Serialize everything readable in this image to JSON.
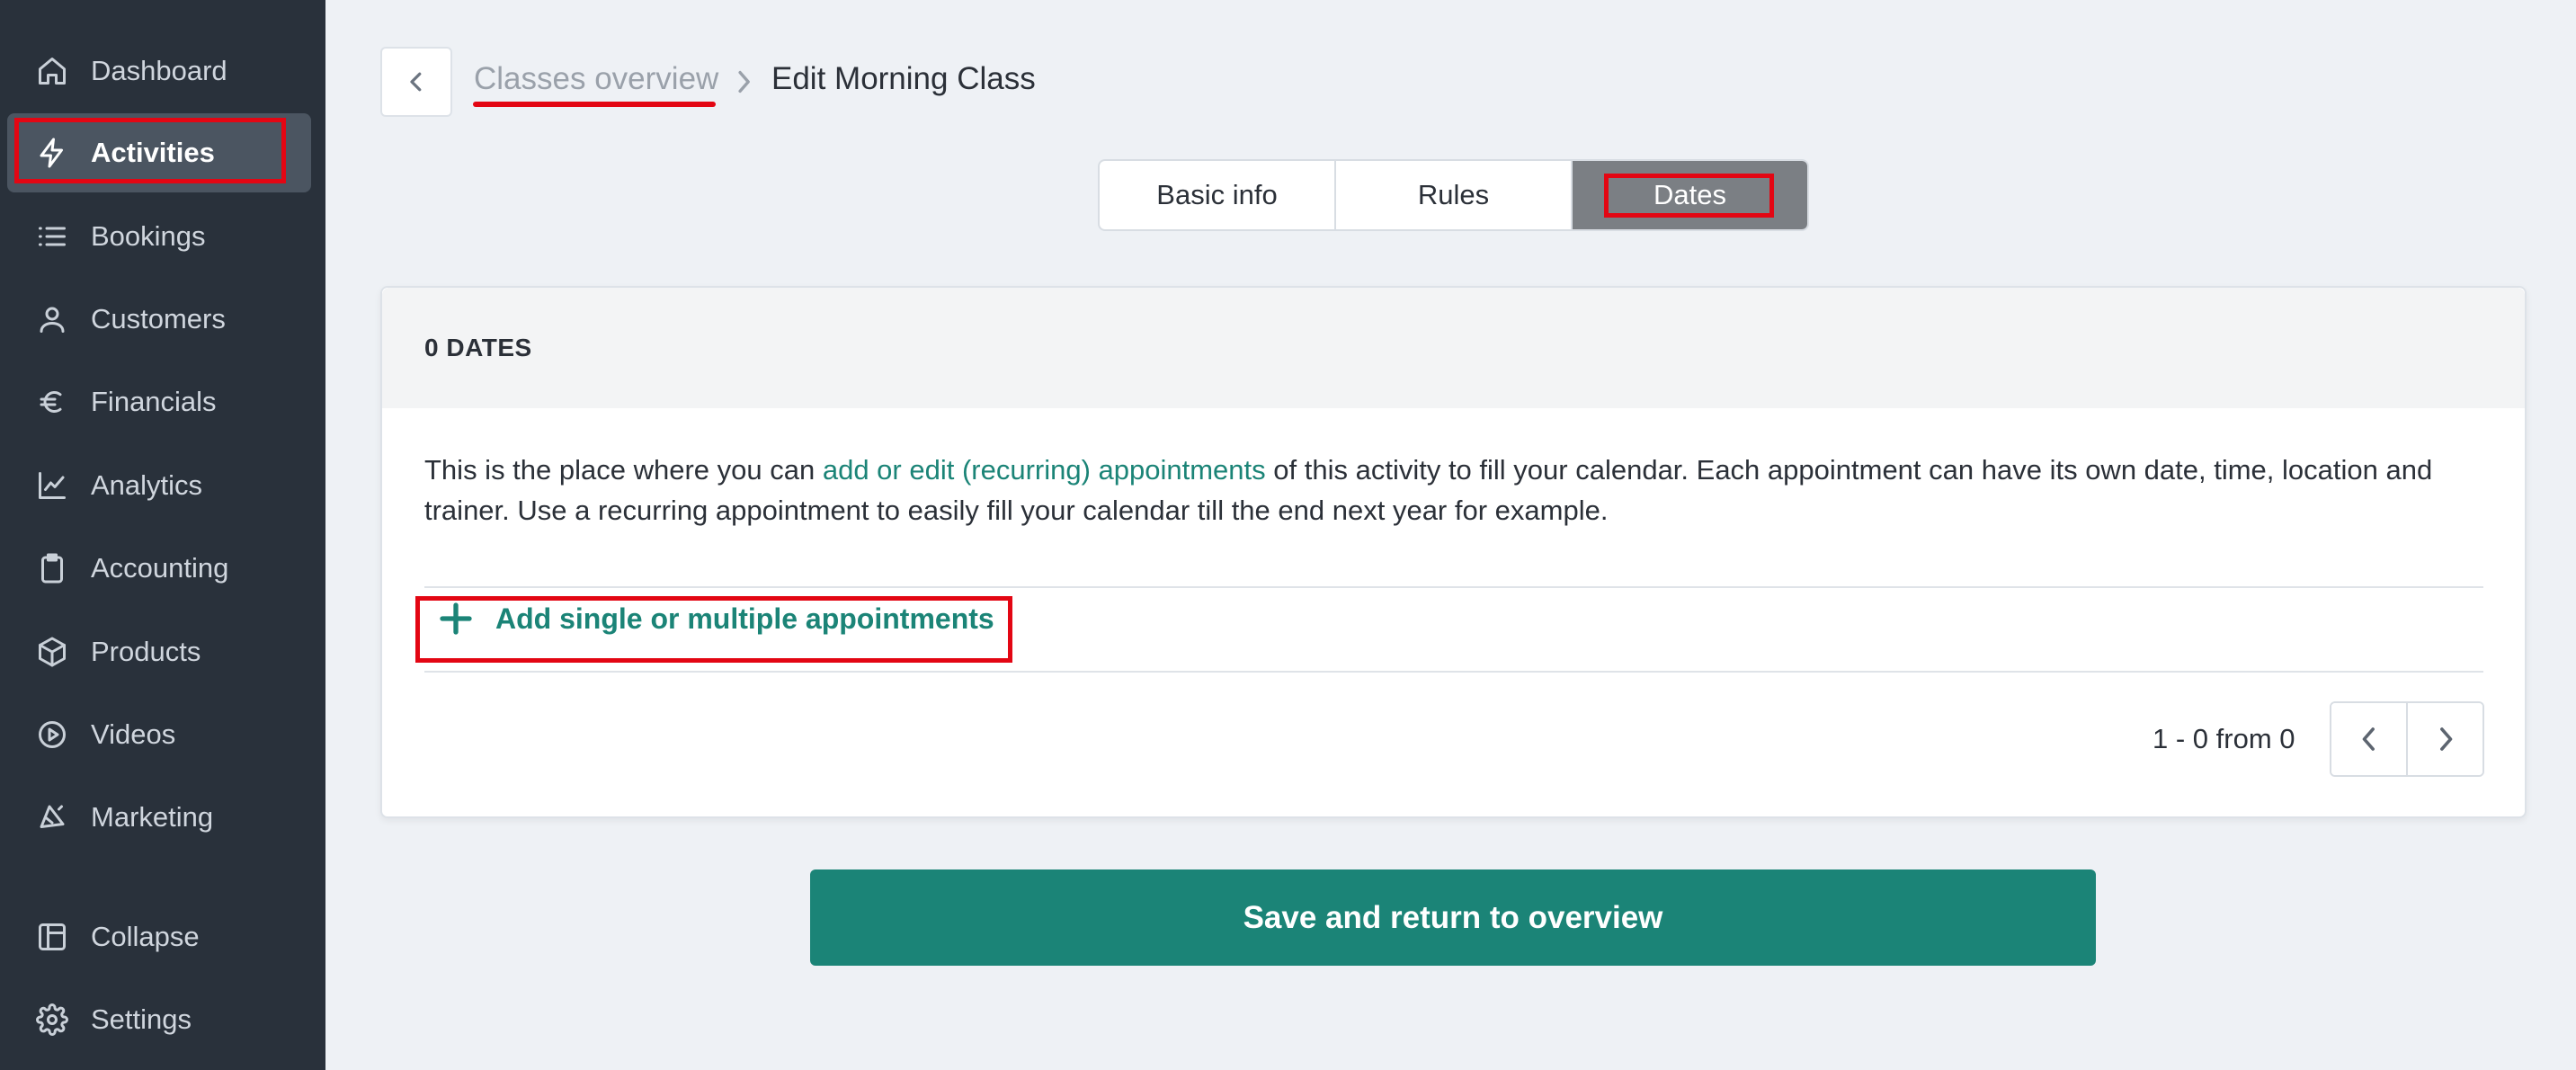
{
  "sidebar": {
    "items": [
      {
        "label": "Dashboard",
        "icon": "home-icon"
      },
      {
        "label": "Activities",
        "icon": "lightning-icon",
        "active": true
      },
      {
        "label": "Bookings",
        "icon": "list-icon"
      },
      {
        "label": "Customers",
        "icon": "user-icon"
      },
      {
        "label": "Financials",
        "icon": "euro-icon"
      },
      {
        "label": "Analytics",
        "icon": "chart-line-icon"
      },
      {
        "label": "Accounting",
        "icon": "clipboard-icon"
      },
      {
        "label": "Products",
        "icon": "box-icon"
      },
      {
        "label": "Videos",
        "icon": "play-circle-icon"
      },
      {
        "label": "Marketing",
        "icon": "megaphone-icon"
      }
    ],
    "bottom": [
      {
        "label": "Collapse",
        "icon": "layout-icon"
      },
      {
        "label": "Settings",
        "icon": "gear-icon"
      }
    ]
  },
  "breadcrumb": {
    "parent": "Classes overview",
    "current": "Edit Morning Class"
  },
  "tabs": [
    {
      "label": "Basic info"
    },
    {
      "label": "Rules"
    },
    {
      "label": "Dates",
      "active": true
    }
  ],
  "card": {
    "title": "0 DATES",
    "description": {
      "before": "This is the place where you can ",
      "link": "add or edit (recurring) appointments",
      "after": " of this activity to fill your calendar. Each appointment can have its own date, time, location and trainer. Use a recurring appointment to easily fill your calendar till the end next year for example."
    },
    "add_label": "Add single or multiple appointments",
    "pager_text": "1 - 0 from 0"
  },
  "save_label": "Save and return to overview",
  "colors": {
    "sidebar_bg": "#29313b",
    "accent": "#1b8477",
    "highlight": "#e30613",
    "active_tab": "#7b7f84"
  }
}
